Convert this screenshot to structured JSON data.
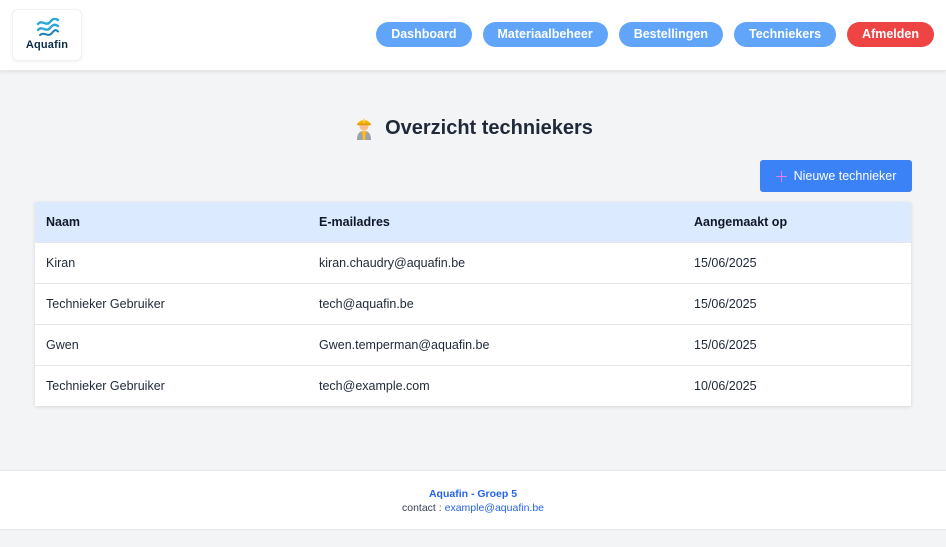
{
  "brand": {
    "name": "Aquafin",
    "color": "#0b2a47"
  },
  "nav": {
    "items": [
      "Dashboard",
      "Materiaalbeheer",
      "Bestellingen",
      "Techniekers"
    ],
    "logout": "Afmelden",
    "accent": "#60a5fa",
    "logout_color": "#ef4444"
  },
  "page": {
    "title": "Overzicht techniekers",
    "title_icon": "construction-worker-icon",
    "new_button": "Nieuwe technieker",
    "new_button_icon": "plus-icon"
  },
  "table": {
    "headers": [
      "Naam",
      "E-mailadres",
      "Aangemaakt op"
    ],
    "rows": [
      [
        "Kiran",
        "kiran.chaudry@aquafin.be",
        "15/06/2025"
      ],
      [
        "Technieker Gebruiker",
        "tech@aquafin.be",
        "15/06/2025"
      ],
      [
        "Gwen",
        "Gwen.temperman@aquafin.be",
        "15/06/2025"
      ],
      [
        "Technieker Gebruiker",
        "tech@example.com",
        "10/06/2025"
      ]
    ]
  },
  "footer": {
    "title": "Aquafin - Groep 5",
    "contact_label": "contact :",
    "contact_email": "example@aquafin.be"
  }
}
